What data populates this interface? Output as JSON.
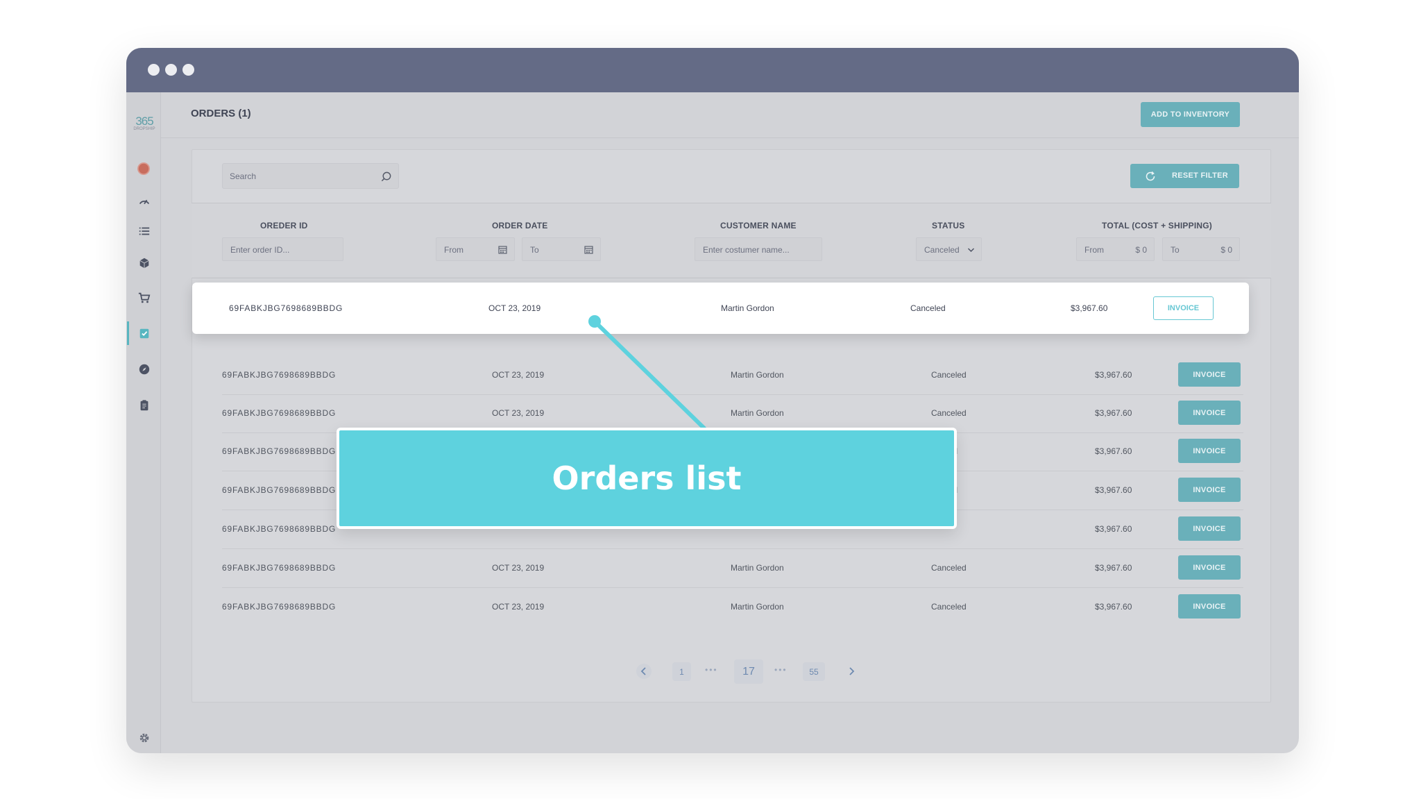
{
  "window": {
    "dots": 3
  },
  "logo": {
    "number": "365",
    "sub": "DROPSHIP"
  },
  "sidebar": {
    "items": [
      "avatar",
      "dashboard-icon",
      "list-icon",
      "box-icon",
      "cart-icon",
      "orders-check-icon",
      "compass-icon",
      "clipboard-icon"
    ],
    "settings_icon": "gear-icon"
  },
  "header": {
    "title": "ORDERS (1)",
    "add_button": "ADD TO INVENTORY"
  },
  "toolbar": {
    "search_placeholder": "Search",
    "reset_label": "RESET FILTER"
  },
  "columns": {
    "order_id": "OREDER ID",
    "order_date": "ORDER DATE",
    "customer": "CUSTOMER NAME",
    "status": "STATUS",
    "total": "TOTAL (COST + SHIPPING)"
  },
  "filters": {
    "order_id_placeholder": "Enter order ID...",
    "date_from": "From",
    "date_to": "To",
    "customer_placeholder": "Enter costumer name...",
    "status_value": "Canceled",
    "total_from": "From",
    "total_from_value": "$ 0",
    "total_to": "To",
    "total_to_value": "$ 0"
  },
  "highlight_row": {
    "id": "69FABKJBG7698689BBDG",
    "date": "OCT 23, 2019",
    "customer": "Martin Gordon",
    "status": "Canceled",
    "total": "$3,967.60",
    "action": "INVOICE"
  },
  "rows": [
    {
      "id": "69FABKJBG7698689BBDG",
      "date": "OCT 23, 2019",
      "customer": "Martin Gordon",
      "status": "Canceled",
      "total": "$3,967.60",
      "action": "INVOICE"
    },
    {
      "id": "69FABKJBG7698689BBDG",
      "date": "OCT 23, 2019",
      "customer": "Martin Gordon",
      "status": "Canceled",
      "total": "$3,967.60",
      "action": "INVOICE"
    },
    {
      "id": "69FABKJBG7698689BBDG",
      "date": "",
      "customer": "",
      "status": "led",
      "total": "$3,967.60",
      "action": "INVOICE"
    },
    {
      "id": "69FABKJBG7698689BBDG",
      "date": "",
      "customer": "",
      "status": "led",
      "total": "$3,967.60",
      "action": "INVOICE"
    },
    {
      "id": "69FABKJBG7698689BBDG",
      "date": "",
      "customer": "",
      "status": "",
      "total": "$3,967.60",
      "action": "INVOICE"
    },
    {
      "id": "69FABKJBG7698689BBDG",
      "date": "OCT 23, 2019",
      "customer": "Martin Gordon",
      "status": "Canceled",
      "total": "$3,967.60",
      "action": "INVOICE"
    },
    {
      "id": "69FABKJBG7698689BBDG",
      "date": "OCT 23, 2019",
      "customer": "Martin Gordon",
      "status": "Canceled",
      "total": "$3,967.60",
      "action": "INVOICE"
    }
  ],
  "pagination": {
    "first": "1",
    "current": "17",
    "last": "55",
    "ellipsis": "•••"
  },
  "callout": {
    "text": "Orders list"
  },
  "colors": {
    "accent": "#5ed2de",
    "titlebar": "#646b86",
    "button": "#6ab0ba"
  }
}
